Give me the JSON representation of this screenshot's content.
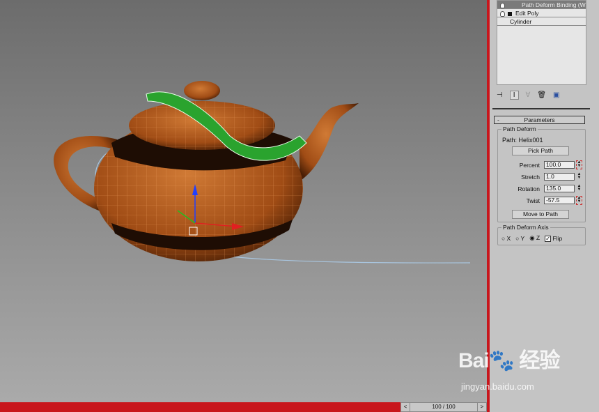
{
  "modifier_stack": [
    {
      "label": "Path Deform Binding (WS",
      "selected": true,
      "icon": "lightbulb-icon"
    },
    {
      "label": "Edit Poly",
      "selected": false,
      "icon": "lightbulb-icon"
    },
    {
      "label": "Cylinder",
      "selected": false
    }
  ],
  "stack_tools": [
    "pin-stack-icon",
    "show-end-result-icon",
    "make-unique-icon",
    "remove-modifier-icon",
    "configure-modifier-sets-icon"
  ],
  "parameters": {
    "rollout_title": "Parameters",
    "collapse": "-",
    "group_title": "Path Deform",
    "path_label": "Path: Helix001",
    "pick_path": "Pick Path",
    "fields": [
      {
        "label": "Percent",
        "value": "100.0"
      },
      {
        "label": "Stretch",
        "value": "1.0"
      },
      {
        "label": "Rotation",
        "value": "135.0"
      },
      {
        "label": "Twist",
        "value": "-57.5"
      }
    ],
    "move_to_path": "Move to Path",
    "axis_group": "Path Deform Axis",
    "axes": [
      {
        "label": "X",
        "checked": false
      },
      {
        "label": "Y",
        "checked": false
      },
      {
        "label": "Z",
        "checked": true
      }
    ],
    "flip_label": "Flip",
    "flip_checked": true
  },
  "timeline": {
    "prev": "<",
    "frame": "100 / 100",
    "next": ">"
  },
  "watermark": {
    "logo": "Bai 经验",
    "url": "jingyan.baidu.com"
  },
  "colors": {
    "accent_red": "#c8161c",
    "teapot": "#b8591d",
    "snake": "#22a12a"
  }
}
